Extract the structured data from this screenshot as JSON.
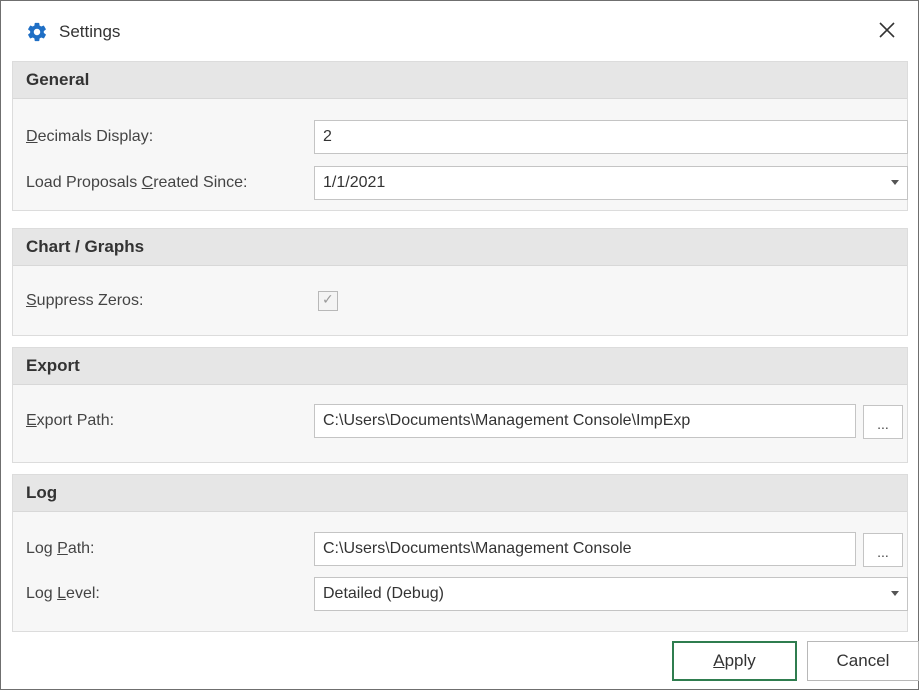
{
  "window": {
    "title": "Settings",
    "title_icon": "gear-icon",
    "close_glyph": "✕"
  },
  "sections": {
    "general": {
      "header": "General",
      "decimals": {
        "label_mnemonic": "D",
        "label_rest": "ecimals Display:",
        "value": "2"
      },
      "load_since": {
        "label_before": "Load Proposals ",
        "label_mnemonic": "C",
        "label_after": "reated Since:",
        "value": "1/1/2021"
      }
    },
    "chart": {
      "header": "Chart / Graphs",
      "suppress": {
        "label_mnemonic": "S",
        "label_rest": "uppress Zeros:",
        "checked": true,
        "check_glyph": "✓"
      }
    },
    "export": {
      "header": "Export",
      "path": {
        "label_mnemonic": "E",
        "label_rest": "xport Path:",
        "value": "C:\\Users\\Documents\\Management Console\\ImpExp",
        "browse_label": "..."
      }
    },
    "log": {
      "header": "Log",
      "path": {
        "label_before": "Log ",
        "label_mnemonic": "P",
        "label_after": "ath:",
        "value": "C:\\Users\\Documents\\Management Console",
        "browse_label": "..."
      },
      "level": {
        "label_before": "Log ",
        "label_mnemonic": "L",
        "label_after": "evel:",
        "value": "Detailed (Debug)"
      }
    }
  },
  "buttons": {
    "apply_mnemonic": "A",
    "apply_rest": "pply",
    "cancel": "Cancel"
  },
  "colors": {
    "apply_border": "#2f7d4f",
    "gear": "#1f6fc5"
  }
}
